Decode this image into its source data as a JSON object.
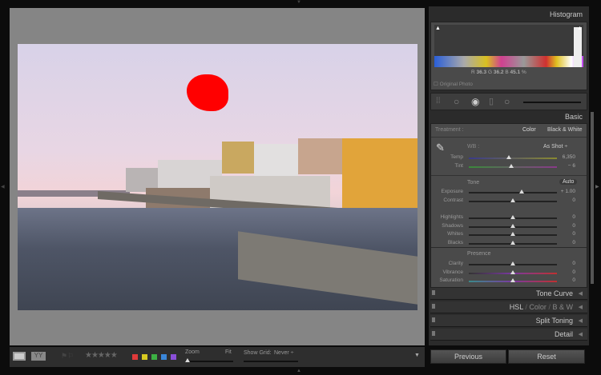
{
  "histogram": {
    "title": "Histogram",
    "r_label": "R",
    "r": "36.3",
    "g_label": "G",
    "g": "36.2",
    "b_label": "B",
    "b": "45.1",
    "pct": "%",
    "original_photo": "Original Photo"
  },
  "basic": {
    "title": "Basic",
    "treatment_label": "Treatment :",
    "color": "Color",
    "bw": "Black & White",
    "wb_label": "WB :",
    "wb_value": "As Shot",
    "wb_sliders": [
      {
        "label": "Temp",
        "value": "6,350",
        "pos": 0.45
      },
      {
        "label": "Tint",
        "value": "− 6",
        "pos": 0.48
      }
    ],
    "tone_label": "Tone",
    "auto": "Auto",
    "tone_sliders": [
      {
        "label": "Exposure",
        "value": "+ 1.00",
        "pos": 0.6
      },
      {
        "label": "Contrast",
        "value": "0",
        "pos": 0.5
      }
    ],
    "tone2_sliders": [
      {
        "label": "Highlights",
        "value": "0",
        "pos": 0.5
      },
      {
        "label": "Shadows",
        "value": "0",
        "pos": 0.5
      },
      {
        "label": "Whites",
        "value": "0",
        "pos": 0.5
      },
      {
        "label": "Blacks",
        "value": "0",
        "pos": 0.5
      }
    ],
    "presence_label": "Presence",
    "presence_sliders": [
      {
        "label": "Clarity",
        "value": "0",
        "pos": 0.5
      },
      {
        "label": "Vibrance",
        "value": "0",
        "pos": 0.5
      },
      {
        "label": "Saturation",
        "value": "0",
        "pos": 0.5
      }
    ]
  },
  "panels": {
    "tone_curve": "Tone Curve",
    "hsl": "HSL",
    "color": "Color",
    "bw": "B & W",
    "sep": "/",
    "split_toning": "Split Toning",
    "detail": "Detail"
  },
  "buttons": {
    "previous": "Previous",
    "reset": "Reset"
  },
  "toolbar": {
    "zoom": "Zoom",
    "fit": "Fit",
    "show_grid": "Show Grid:",
    "grid_value": "Never",
    "stars": "★★★★★",
    "colors": [
      "#e03a3a",
      "#d8c a20",
      "#3cb043",
      "#3a86d8",
      "#8a4fd8"
    ]
  }
}
